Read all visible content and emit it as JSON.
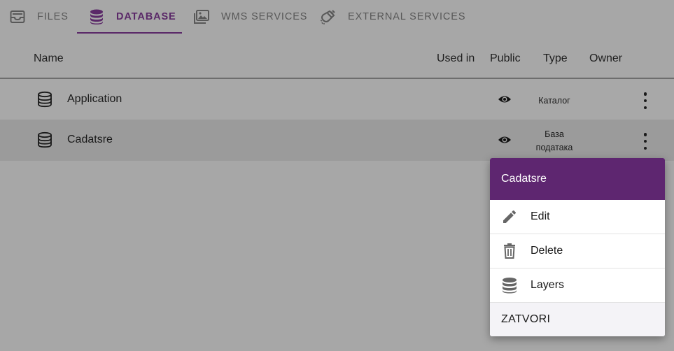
{
  "tabs": [
    {
      "label": "FILES",
      "icon": "inbox-icon",
      "active": false
    },
    {
      "label": "DATABASE",
      "icon": "database-icon",
      "active": true
    },
    {
      "label": "WMS SERVICES",
      "icon": "image-icon",
      "active": false
    },
    {
      "label": "EXTERNAL SERVICES",
      "icon": "magnet-icon",
      "active": false
    }
  ],
  "table": {
    "columns": [
      "Name",
      "Used in",
      "Public",
      "Type",
      "Owner"
    ],
    "rows": [
      {
        "name": "Application",
        "public_icon": "eye-icon",
        "type_line1": "Каталог",
        "type_line2": ""
      },
      {
        "name": "Cadatsre",
        "public_icon": "eye-icon",
        "type_line1": "База",
        "type_line2": "података"
      }
    ]
  },
  "menu": {
    "title": "Cadatsre",
    "items": [
      {
        "label": "Edit",
        "icon": "pencil-icon"
      },
      {
        "label": "Delete",
        "icon": "trash-icon"
      },
      {
        "label": "Layers",
        "icon": "database-icon"
      }
    ],
    "close_label": "ZATVORI"
  },
  "colors": {
    "accent": "#5e2670",
    "overlay_bg": "#a7a7a7",
    "selected_row": "#9b9b9b"
  }
}
